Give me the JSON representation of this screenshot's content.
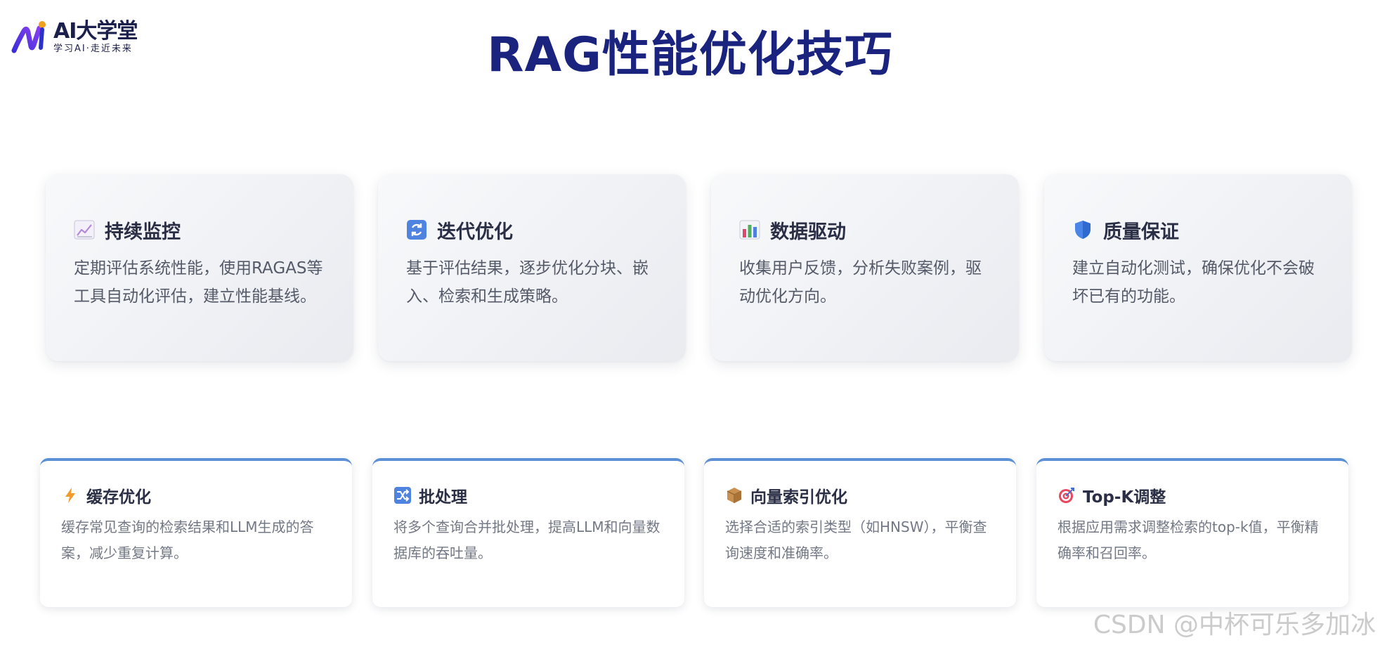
{
  "logo": {
    "title": "AI大学堂",
    "subtitle": "学习AI·走近未来"
  },
  "page_title": "RAG性能优化技巧",
  "top_cards": [
    {
      "icon": "line-chart-icon",
      "title": "持续监控",
      "description": "定期评估系统性能，使用RAGAS等工具自动化评估，建立性能基线。"
    },
    {
      "icon": "refresh-icon",
      "title": "迭代优化",
      "description": "基于评估结果，逐步优化分块、嵌入、检索和生成策略。"
    },
    {
      "icon": "bar-chart-icon",
      "title": "数据驱动",
      "description": "收集用户反馈，分析失败案例，驱动优化方向。"
    },
    {
      "icon": "shield-icon",
      "title": "质量保证",
      "description": "建立自动化测试，确保优化不会破坏已有的功能。"
    }
  ],
  "bottom_cards": [
    {
      "icon": "lightning-icon",
      "title": "缓存优化",
      "description": "缓存常见查询的检索结果和LLM生成的答案，减少重复计算。"
    },
    {
      "icon": "shuffle-icon",
      "title": "批处理",
      "description": "将多个查询合并批处理，提高LLM和向量数据库的吞吐量。"
    },
    {
      "icon": "package-icon",
      "title": "向量索引优化",
      "description": "选择合适的索引类型（如HNSW），平衡查询速度和准确率。"
    },
    {
      "icon": "target-icon",
      "title": "Top-K调整",
      "description": "根据应用需求调整检索的top-k值，平衡精确率和召回率。"
    }
  ],
  "watermark": "CSDN @中杯可乐多加冰",
  "colors": {
    "title": "#1a237e",
    "accent": "#5b8fd6",
    "card_title": "#2b2f45",
    "top_desc": "#555a68",
    "bottom_desc": "#737885"
  }
}
